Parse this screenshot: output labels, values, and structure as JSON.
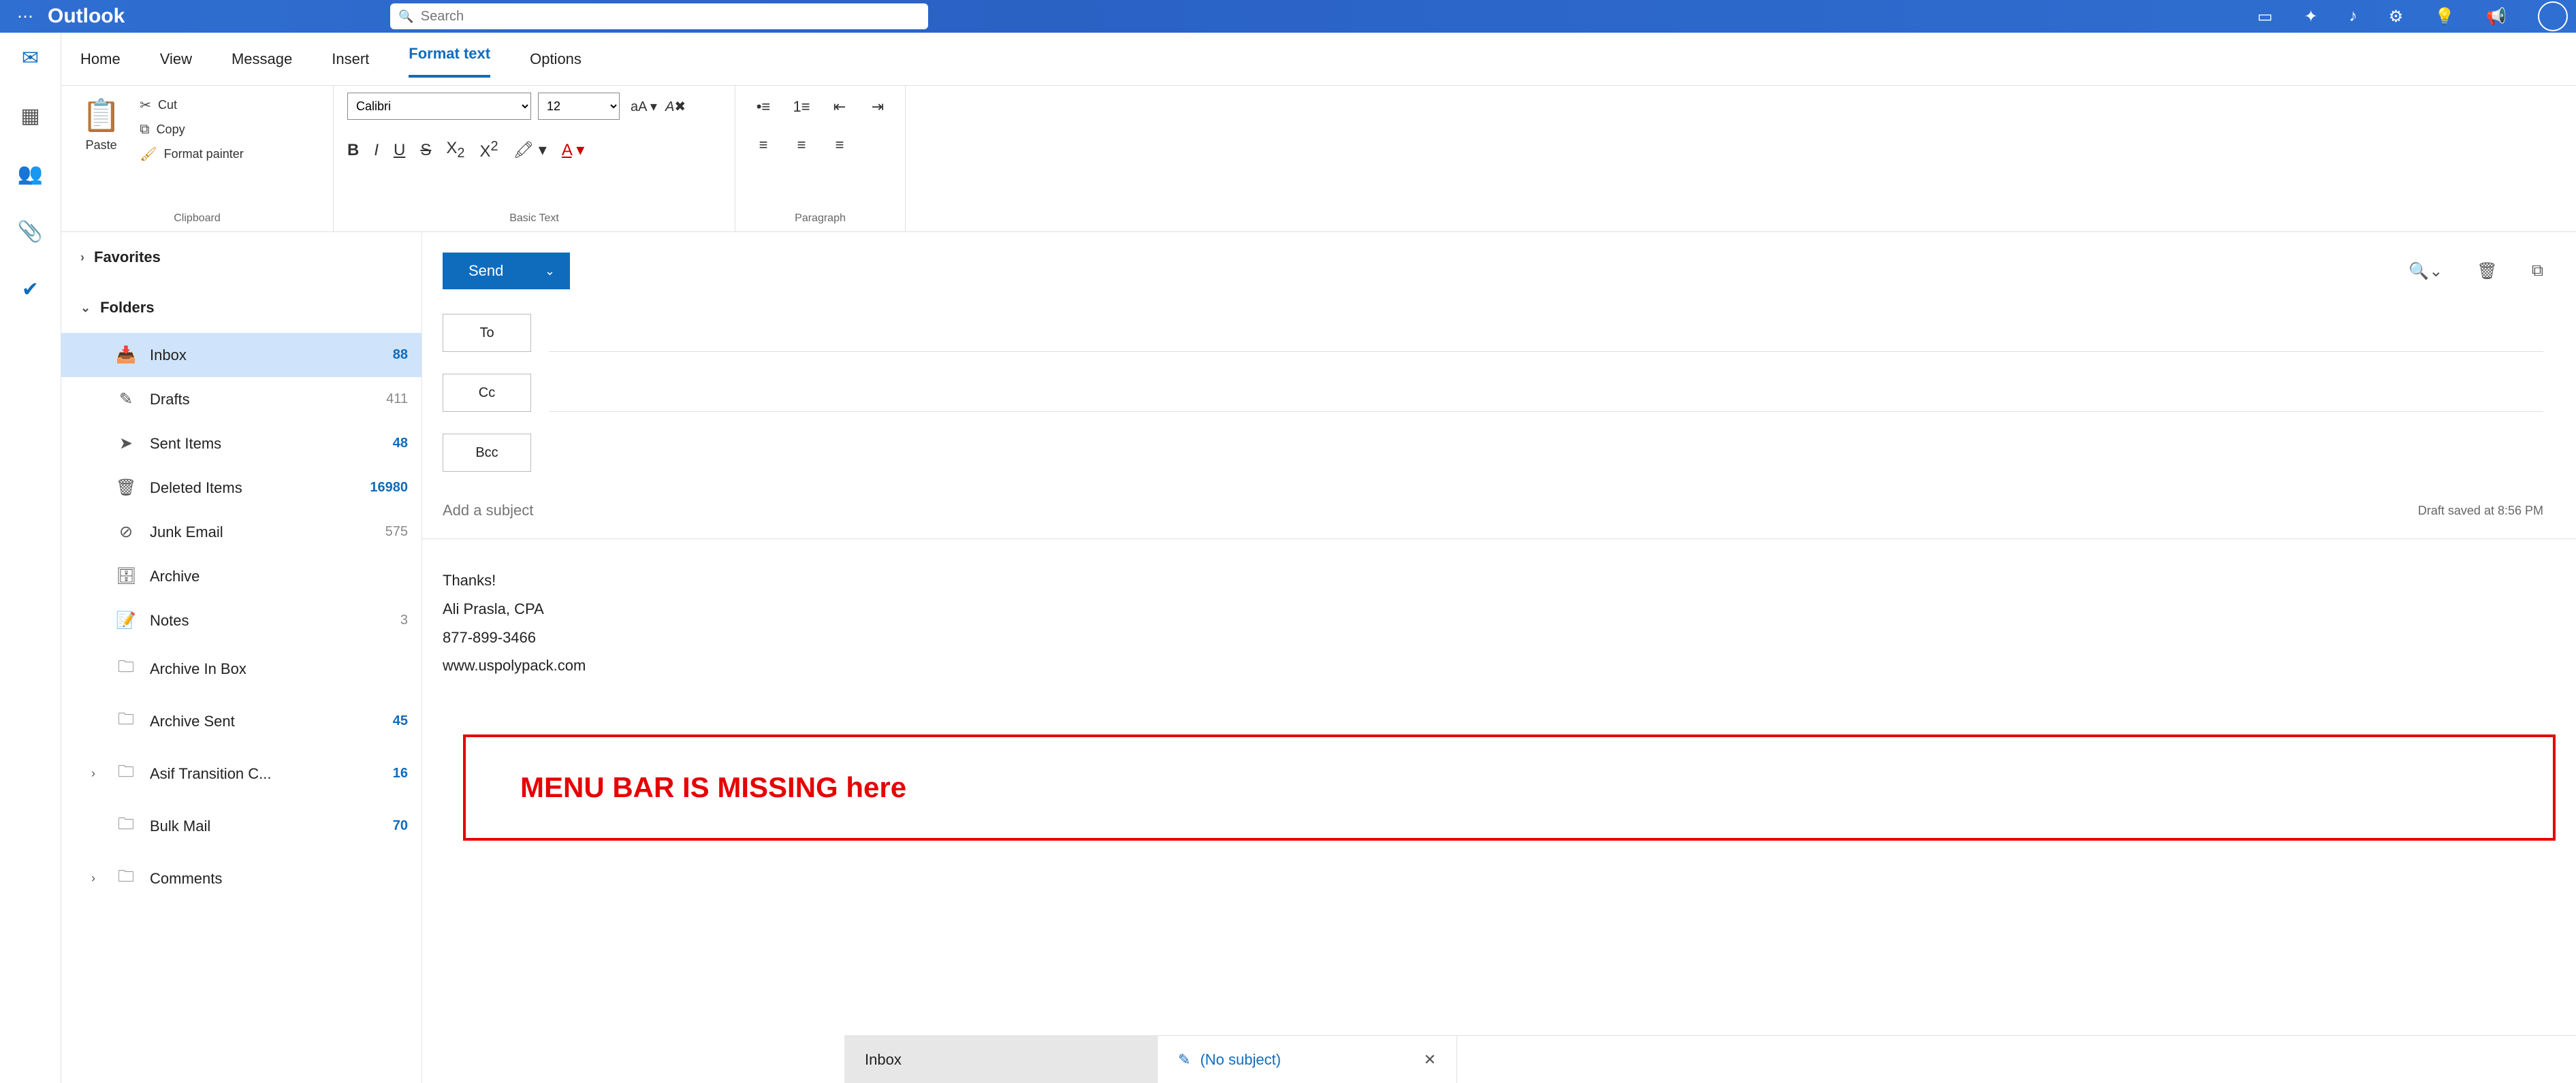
{
  "topbar": {
    "app_name": "Outlook",
    "search_placeholder": "Search"
  },
  "tabs": {
    "home": "Home",
    "view": "View",
    "message": "Message",
    "insert": "Insert",
    "format_text": "Format text",
    "options": "Options"
  },
  "ribbon": {
    "paste": "Paste",
    "cut": "Cut",
    "copy": "Copy",
    "format_painter": "Format painter",
    "clipboard_label": "Clipboard",
    "font_name": "Calibri",
    "font_size": "12",
    "basic_text_label": "Basic Text",
    "paragraph_label": "Paragraph"
  },
  "folder_pane": {
    "favorites": "Favorites",
    "folders": "Folders",
    "items": [
      {
        "icon": "inbox",
        "name": "Inbox",
        "count": "88",
        "blue": true,
        "active": true
      },
      {
        "icon": "drafts",
        "name": "Drafts",
        "count": "411",
        "blue": false
      },
      {
        "icon": "sent",
        "name": "Sent Items",
        "count": "48",
        "blue": true
      },
      {
        "icon": "deleted",
        "name": "Deleted Items",
        "count": "16980",
        "blue": true
      },
      {
        "icon": "junk",
        "name": "Junk Email",
        "count": "575",
        "blue": false
      },
      {
        "icon": "archive",
        "name": "Archive",
        "count": "",
        "blue": false
      },
      {
        "icon": "notes",
        "name": "Notes",
        "count": "3",
        "blue": false
      },
      {
        "icon": "folder",
        "name": "Archive In Box",
        "count": "",
        "blue": false
      },
      {
        "icon": "folder",
        "name": "Archive Sent",
        "count": "45",
        "blue": true
      },
      {
        "icon": "folder",
        "name": "Asif Transition C...",
        "count": "16",
        "blue": true,
        "expandable": true
      },
      {
        "icon": "folder",
        "name": "Bulk Mail",
        "count": "70",
        "blue": true
      },
      {
        "icon": "folder",
        "name": "Comments",
        "count": "",
        "blue": false,
        "expandable": true
      }
    ]
  },
  "compose": {
    "send": "Send",
    "to": "To",
    "cc": "Cc",
    "bcc": "Bcc",
    "subject_placeholder": "Add a subject",
    "save_text": "Draft saved at 8:56 PM",
    "body_lines": [
      "Thanks!",
      "Ali Prasla, CPA",
      "877-899-3466",
      "www.uspolypack.com"
    ],
    "annotation": "MENU BAR IS MISSING here"
  },
  "bottom_tabs": {
    "inbox": "Inbox",
    "no_subject": "(No subject)"
  }
}
